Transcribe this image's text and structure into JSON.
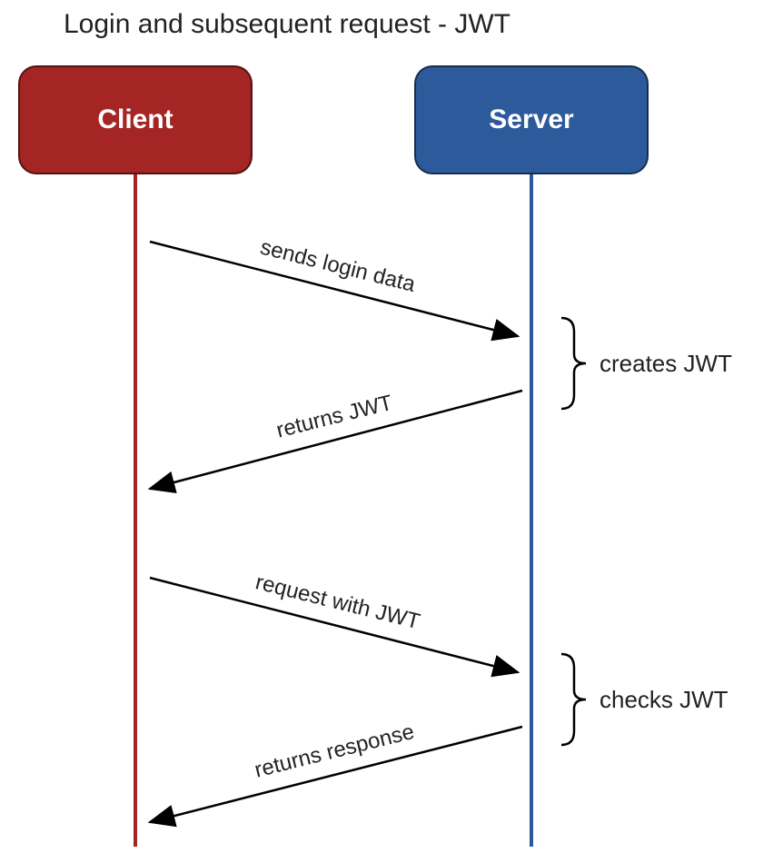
{
  "title": "Login and subsequent request - JWT",
  "participants": {
    "client": {
      "label": "Client",
      "color": "#a52424"
    },
    "server": {
      "label": "Server",
      "color": "#2d5a9b"
    }
  },
  "messages": [
    {
      "id": "m1",
      "from": "client",
      "to": "server",
      "label": "sends login data"
    },
    {
      "id": "m2",
      "from": "server",
      "to": "client",
      "label": "returns JWT"
    },
    {
      "id": "m3",
      "from": "client",
      "to": "server",
      "label": "request with JWT"
    },
    {
      "id": "m4",
      "from": "server",
      "to": "client",
      "label": "returns response"
    }
  ],
  "notes": [
    {
      "id": "n1",
      "on": "server",
      "label": "creates JWT",
      "between": [
        "m1",
        "m2"
      ]
    },
    {
      "id": "n2",
      "on": "server",
      "label": "checks JWT",
      "between": [
        "m3",
        "m4"
      ]
    }
  ]
}
